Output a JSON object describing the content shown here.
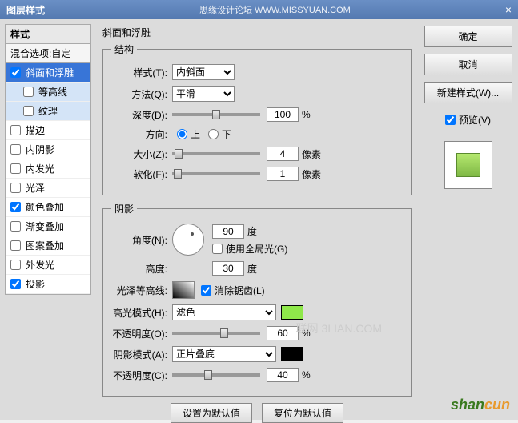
{
  "titlebar": {
    "title": "图层样式",
    "forum": "思缘设计论坛 WWW.MISSYUAN.COM",
    "close": "×"
  },
  "left": {
    "header": "样式",
    "blend": "混合选项:自定",
    "items": [
      {
        "label": "斜面和浮雕",
        "checked": true,
        "selected": true
      },
      {
        "label": "等高线",
        "checked": false,
        "sub": true
      },
      {
        "label": "纹理",
        "checked": false,
        "sub": true
      },
      {
        "label": "描边",
        "checked": false
      },
      {
        "label": "内阴影",
        "checked": false
      },
      {
        "label": "内发光",
        "checked": false
      },
      {
        "label": "光泽",
        "checked": false
      },
      {
        "label": "颜色叠加",
        "checked": true
      },
      {
        "label": "渐变叠加",
        "checked": false
      },
      {
        "label": "图案叠加",
        "checked": false
      },
      {
        "label": "外发光",
        "checked": false
      },
      {
        "label": "投影",
        "checked": true
      }
    ]
  },
  "section_title": "斜面和浮雕",
  "structure": {
    "legend": "结构",
    "style_label": "样式(T):",
    "style_value": "内斜面",
    "method_label": "方法(Q):",
    "method_value": "平滑",
    "depth_label": "深度(D):",
    "depth_value": "100",
    "depth_unit": "%",
    "direction_label": "方向:",
    "up": "上",
    "down": "下",
    "size_label": "大小(Z):",
    "size_value": "4",
    "size_unit": "像素",
    "soften_label": "软化(F):",
    "soften_value": "1",
    "soften_unit": "像素"
  },
  "shading": {
    "legend": "阴影",
    "angle_label": "角度(N):",
    "angle_value": "90",
    "angle_unit": "度",
    "global_label": "使用全局光(G)",
    "altitude_label": "高度:",
    "altitude_value": "30",
    "altitude_unit": "度",
    "gloss_label": "光泽等高线:",
    "antialias_label": "消除锯齿(L)",
    "highlight_label": "高光模式(H):",
    "highlight_value": "滤色",
    "highlight_op_label": "不透明度(O):",
    "highlight_op_value": "60",
    "highlight_op_unit": "%",
    "shadow_label": "阴影模式(A):",
    "shadow_value": "正片叠底",
    "shadow_op_label": "不透明度(C):",
    "shadow_op_value": "40",
    "shadow_op_unit": "%"
  },
  "buttons": {
    "make_default": "设置为默认值",
    "reset_default": "复位为默认值"
  },
  "right": {
    "ok": "确定",
    "cancel": "取消",
    "new_style": "新建样式(W)...",
    "preview": "预览(V)"
  },
  "watermark1": "联网 3LIAN.COM",
  "watermark2a": "shan",
  "watermark2b": "cun"
}
